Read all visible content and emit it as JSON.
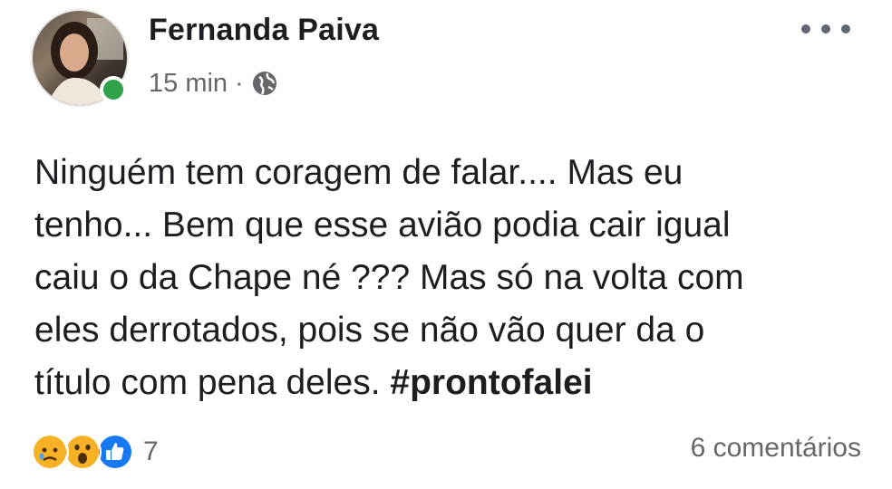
{
  "post": {
    "author": "Fernanda Paiva",
    "timestamp": "15 min",
    "separator": "·",
    "privacy_icon": "globe-icon",
    "more_icon": "more-options-icon",
    "text_lines": [
      "Ninguém tem coragem de falar.... Mas eu",
      "tenho... Bem que esse avião podia cair igual",
      "caiu o da Chape né ??? Mas só na volta com",
      "eles derrotados, pois se não vão quer da o"
    ],
    "last_line_prefix": "título com pena deles. ",
    "hashtag": "#prontofalei",
    "reactions": {
      "icons": [
        "sad-reaction-icon",
        "wow-reaction-icon",
        "like-reaction-icon"
      ],
      "count": "7"
    },
    "comments": "6 comentários"
  },
  "colors": {
    "text": "#1c1e21",
    "muted": "#65676b",
    "online": "#31a24c",
    "like_blue": "#1877f2",
    "reaction_yellow": "#f7b125"
  }
}
